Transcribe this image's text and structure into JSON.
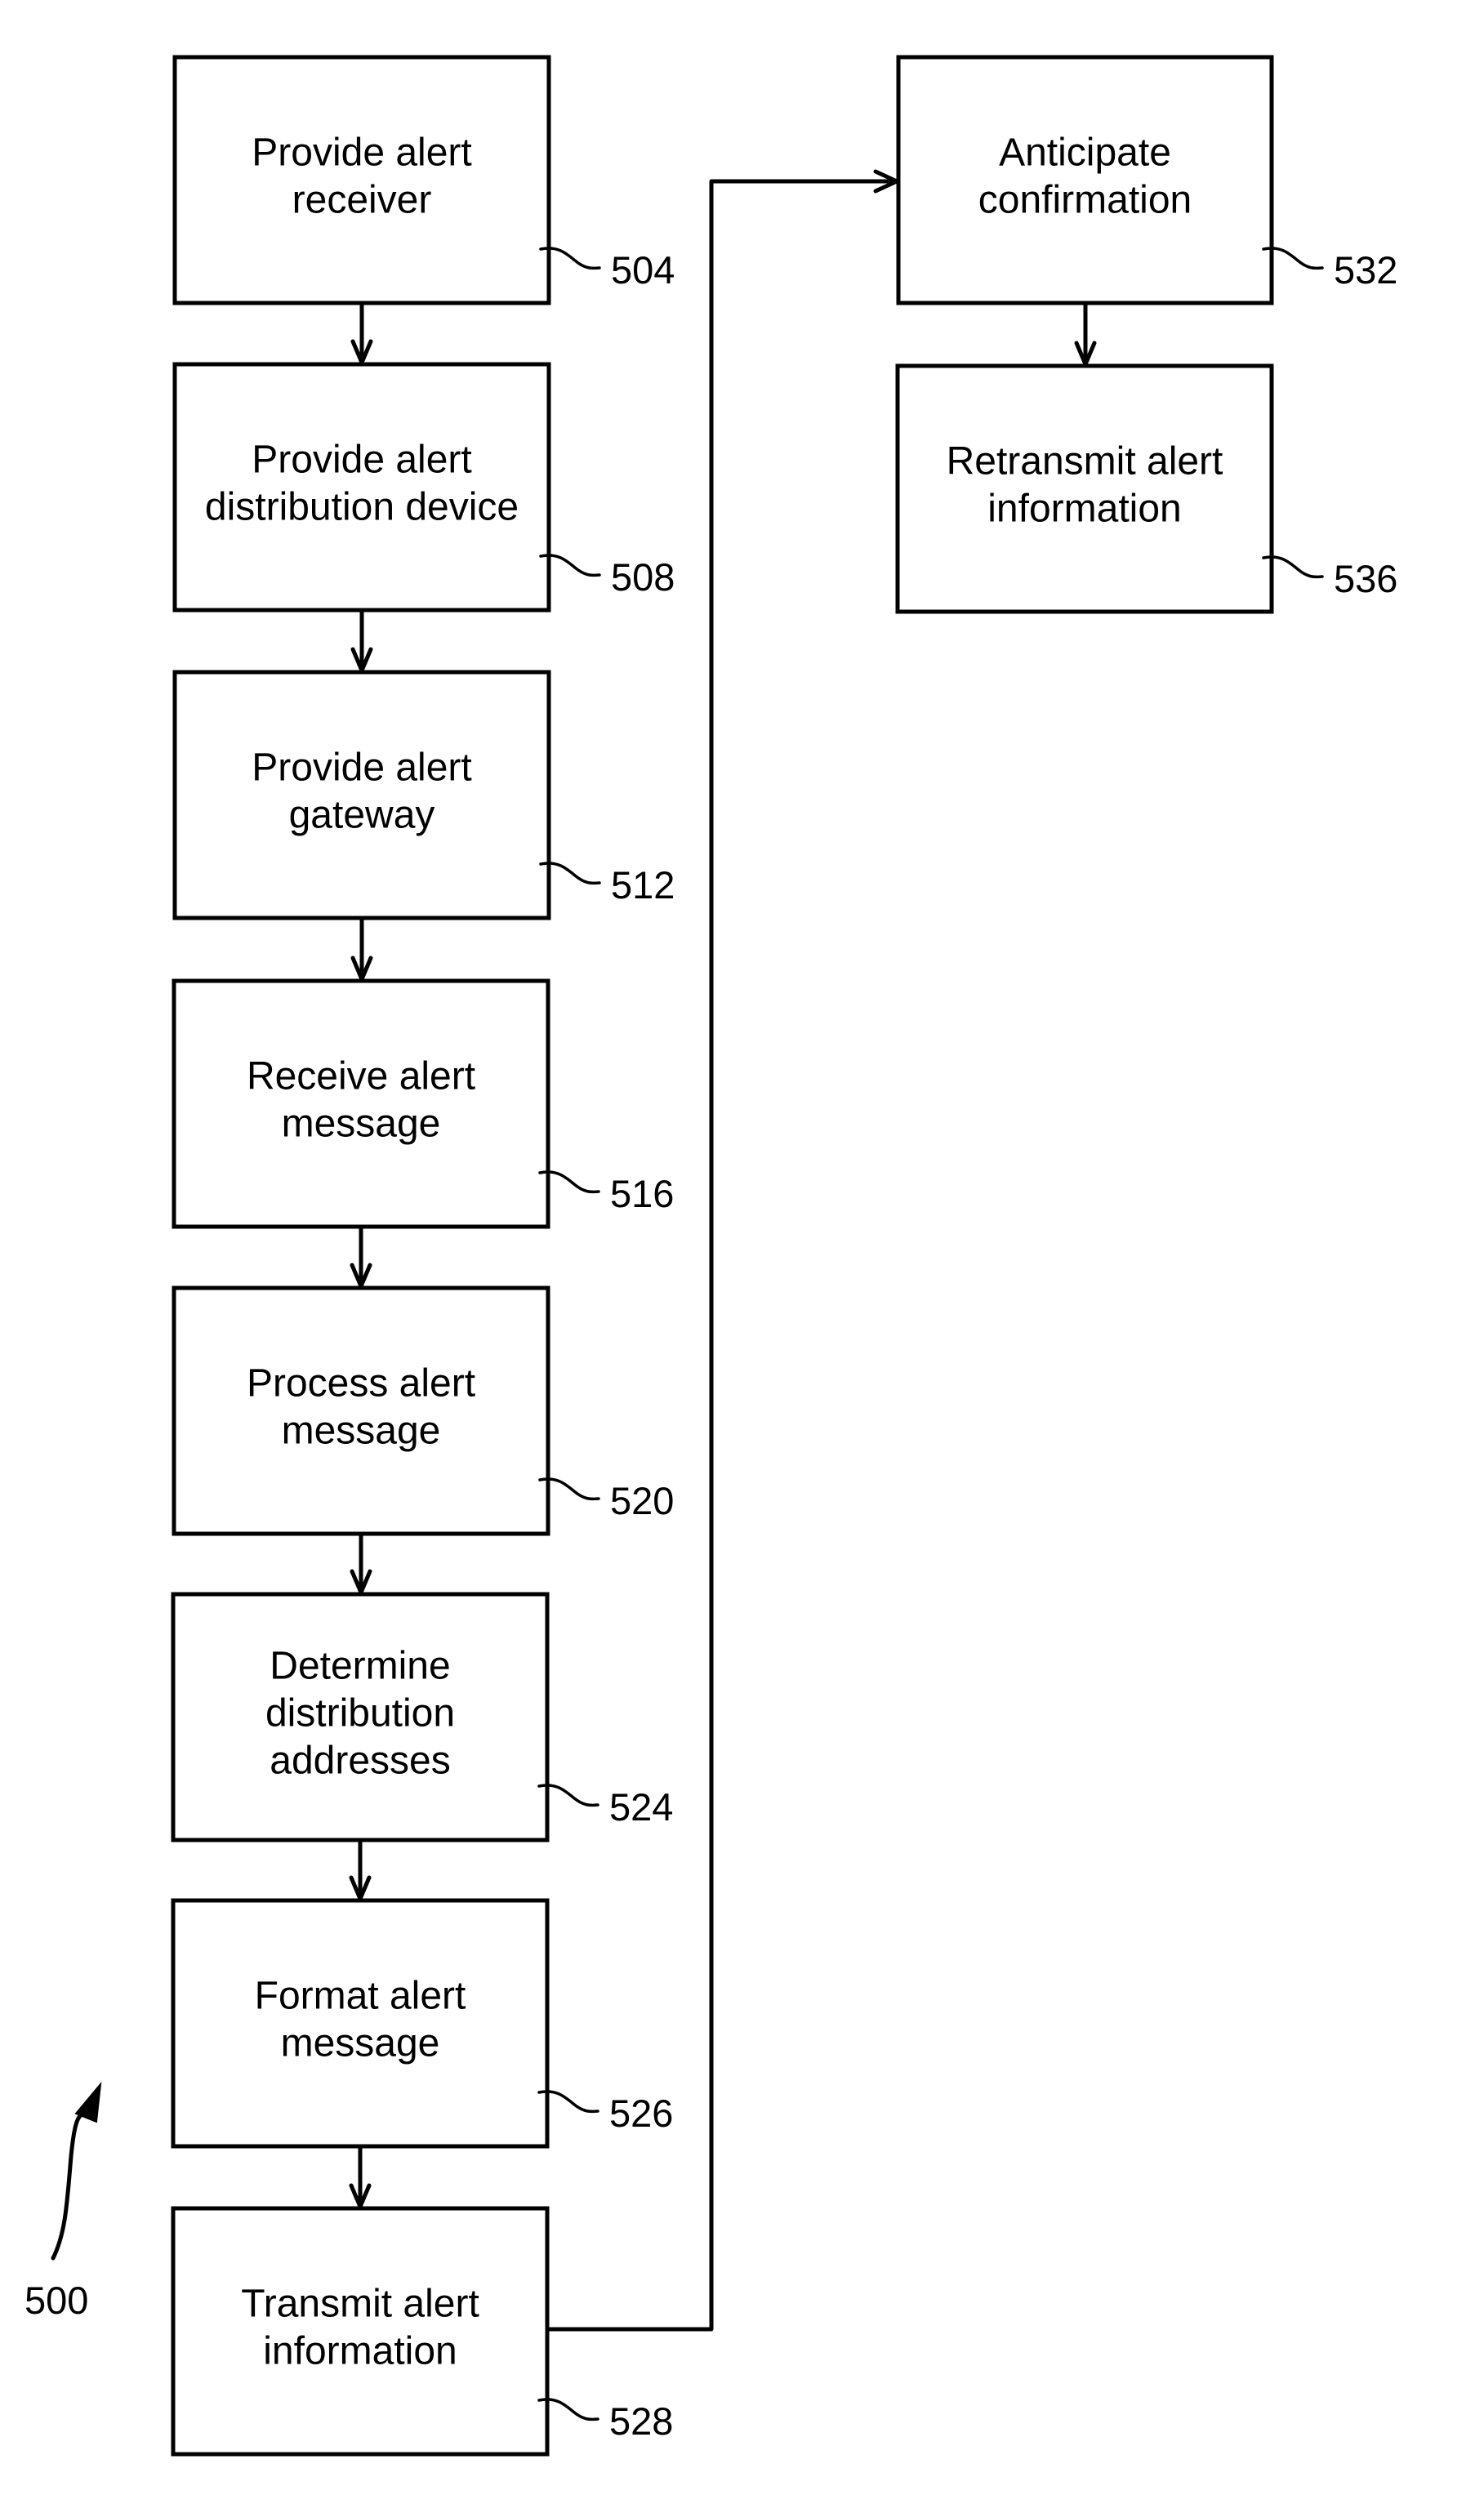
{
  "figure": {
    "reference_label": "500"
  },
  "steps": [
    {
      "id": "504",
      "label": "504",
      "lines": [
        "Provide alert",
        "receiver"
      ]
    },
    {
      "id": "508",
      "label": "508",
      "lines": [
        "Provide alert",
        "distribution device"
      ]
    },
    {
      "id": "512",
      "label": "512",
      "lines": [
        "Provide alert",
        "gateway"
      ]
    },
    {
      "id": "516",
      "label": "516",
      "lines": [
        "Receive alert",
        "message"
      ]
    },
    {
      "id": "520",
      "label": "520",
      "lines": [
        "Process alert",
        "message"
      ]
    },
    {
      "id": "524",
      "label": "524",
      "lines": [
        "Determine",
        "distribution",
        "addresses"
      ]
    },
    {
      "id": "526",
      "label": "526",
      "lines": [
        "Format alert",
        "message"
      ]
    },
    {
      "id": "528",
      "label": "528",
      "lines": [
        "Transmit alert",
        "information"
      ]
    },
    {
      "id": "532",
      "label": "532",
      "lines": [
        "Anticipate",
        "confirmation"
      ]
    },
    {
      "id": "536",
      "label": "536",
      "lines": [
        "Retransmit alert",
        "information"
      ]
    }
  ],
  "edges": [
    {
      "from": "504",
      "to": "508"
    },
    {
      "from": "508",
      "to": "512"
    },
    {
      "from": "512",
      "to": "516"
    },
    {
      "from": "516",
      "to": "520"
    },
    {
      "from": "520",
      "to": "524"
    },
    {
      "from": "524",
      "to": "526"
    },
    {
      "from": "526",
      "to": "528"
    },
    {
      "from": "528",
      "to": "532"
    },
    {
      "from": "532",
      "to": "536"
    }
  ]
}
